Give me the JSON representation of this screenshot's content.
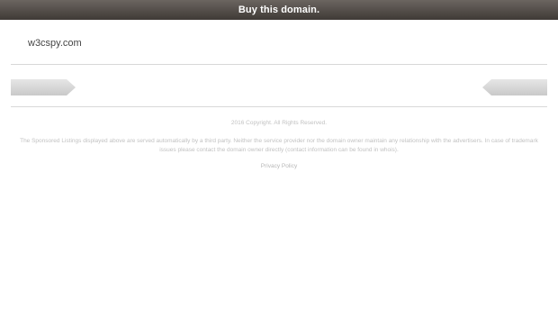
{
  "topbar": {
    "buy_label": "Buy this domain."
  },
  "header": {
    "domain": "w3cspy.com"
  },
  "footer": {
    "copyright": "2016 Copyright. All Rights Reserved.",
    "disclaimer": "The Sponsored Listings displayed above are served automatically by a third party. Neither the service provider nor the domain owner maintain any relationship with the advertisers. In case of trademark issues please contact the domain owner directly (contact information can be found in whois).",
    "privacy_label": "Privacy Policy"
  },
  "colors": {
    "topbar": "#4f4945",
    "divider": "#d8d8d8",
    "footer_text": "#c2c2c2"
  }
}
